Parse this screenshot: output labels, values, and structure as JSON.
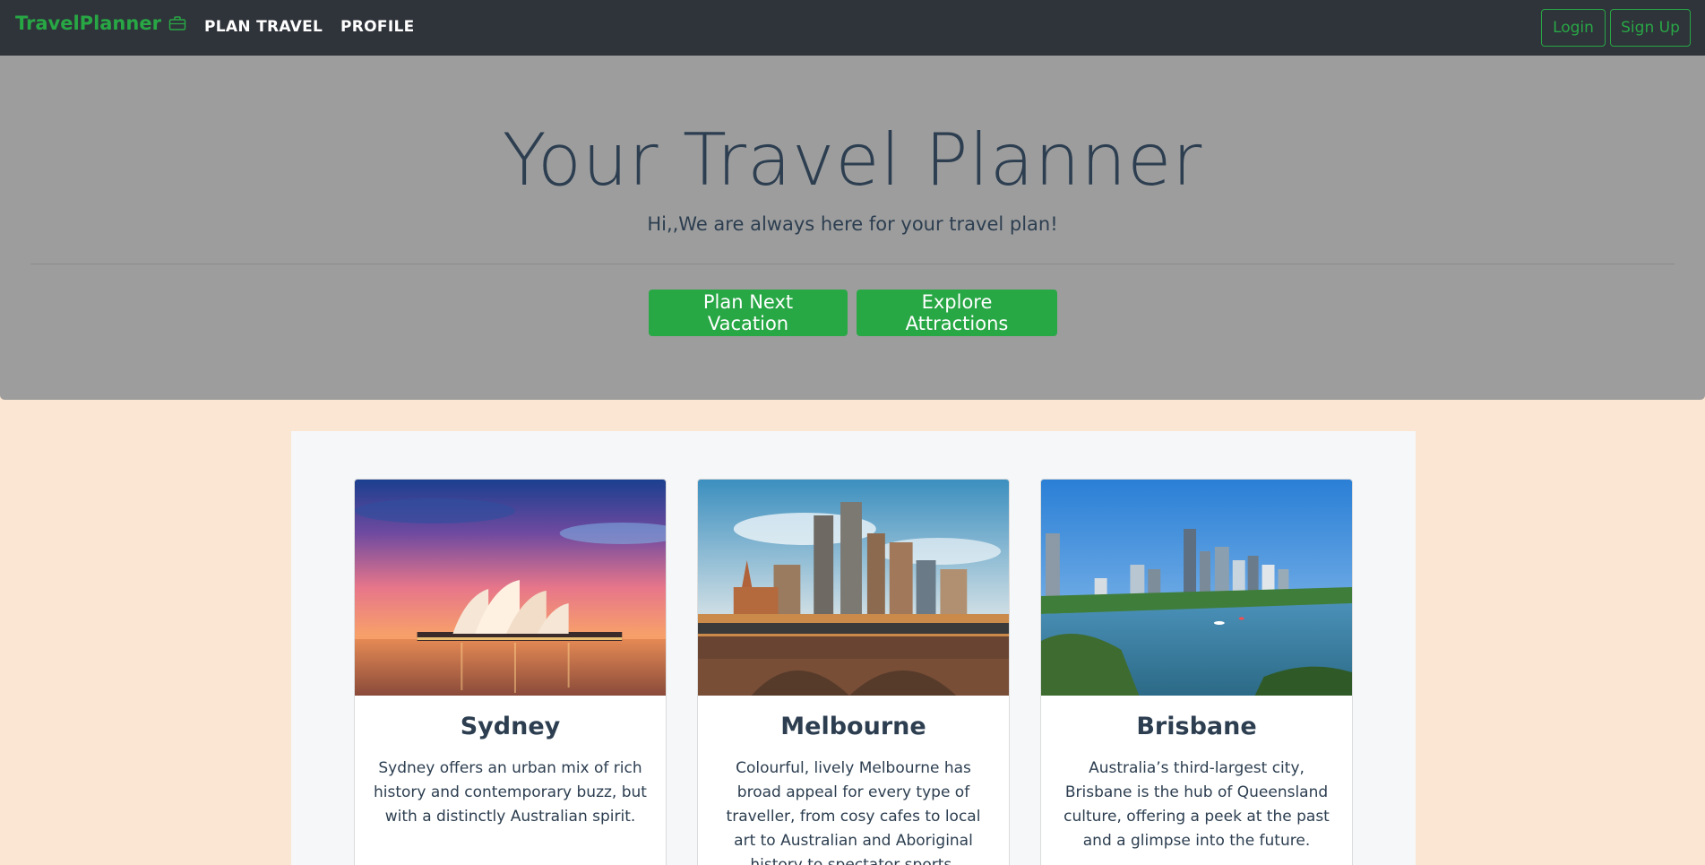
{
  "navbar": {
    "brand": "TravelPlanner",
    "brand_icon": "briefcase-icon",
    "links": [
      "PLAN TRAVEL",
      "PROFILE"
    ],
    "login_label": "Login",
    "signup_label": "Sign Up"
  },
  "hero": {
    "title": "Your Travel Planner",
    "subtitle": "Hi,,We are always here for your travel plan!",
    "primary_button": "Plan Next Vacation",
    "secondary_button": "Explore Attractions"
  },
  "cards": [
    {
      "title": "Sydney",
      "text": "Sydney offers an urban mix of rich history and contemporary buzz, but with a distinctly Australian spirit."
    },
    {
      "title": "Melbourne",
      "text": "Colourful, lively Melbourne has broad appeal for every type of traveller, from cosy cafes to local art to Australian and Aboriginal history to spectator sports."
    },
    {
      "title": "Brisbane",
      "text": "Australia’s third-largest city, Brisbane is the hub of Queensland culture, offering a peek at the past and a glimpse into the future."
    }
  ],
  "colors": {
    "navbar": "#2f333a",
    "accent_green": "#28a745",
    "hero_bg": "#9d9d9d",
    "page_bg": "#fbe6d3",
    "container_bg": "#f6f7f9",
    "text_dark": "#2c3e50"
  }
}
